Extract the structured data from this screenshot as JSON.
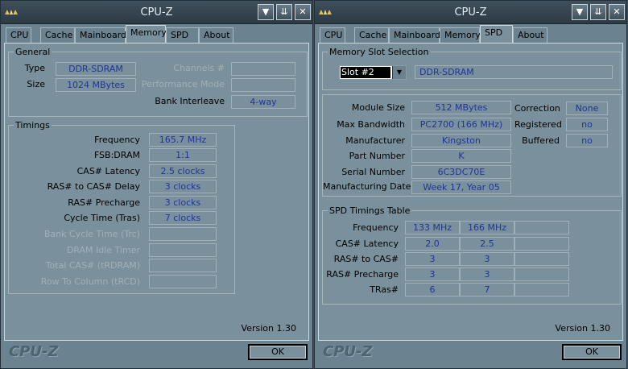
{
  "windows": [
    {
      "title": "CPU-Z",
      "tabs": [
        "CPU",
        "Cache",
        "Mainboard",
        "Memory",
        "SPD",
        "About"
      ],
      "active_tab": "Memory",
      "general": {
        "heading": "General",
        "type_label": "Type",
        "type_value": "DDR-SDRAM",
        "size_label": "Size",
        "size_value": "1024 MBytes",
        "channels_label": "Channels #",
        "channels_value": "",
        "perf_mode_label": "Performance Mode",
        "perf_mode_value": "",
        "bank_interleave_label": "Bank Interleave",
        "bank_interleave_value": "4-way"
      },
      "timings": {
        "heading": "Timings",
        "rows": [
          {
            "label": "Frequency",
            "value": "165.7 MHz",
            "enabled": true
          },
          {
            "label": "FSB:DRAM",
            "value": "1:1",
            "enabled": true
          },
          {
            "label": "CAS# Latency",
            "value": "2.5 clocks",
            "enabled": true
          },
          {
            "label": "RAS# to CAS# Delay",
            "value": "3 clocks",
            "enabled": true
          },
          {
            "label": "RAS# Precharge",
            "value": "3 clocks",
            "enabled": true
          },
          {
            "label": "Cycle Time (Tras)",
            "value": "7 clocks",
            "enabled": true
          },
          {
            "label": "Bank Cycle Time (Trc)",
            "value": "",
            "enabled": false
          },
          {
            "label": "DRAM Idle Timer",
            "value": "",
            "enabled": false
          },
          {
            "label": "Total CAS# (tRDRAM)",
            "value": "",
            "enabled": false
          },
          {
            "label": "Row To Column (tRCD)",
            "value": "",
            "enabled": false
          }
        ]
      },
      "version": "Version 1.30",
      "logo": "CPU-Z",
      "ok_label": "OK"
    },
    {
      "title": "CPU-Z",
      "tabs": [
        "CPU",
        "Cache",
        "Mainboard",
        "Memory",
        "SPD",
        "About"
      ],
      "active_tab": "SPD",
      "slot_selection": {
        "heading": "Memory Slot Selection",
        "selected_slot": "Slot #2",
        "slot_type": "DDR-SDRAM"
      },
      "module": {
        "rows": [
          {
            "label": "Module Size",
            "value": "512 MBytes"
          },
          {
            "label": "Max Bandwidth",
            "value": "PC2700 (166 MHz)"
          },
          {
            "label": "Manufacturer",
            "value": "Kingston"
          },
          {
            "label": "Part Number",
            "value": "K"
          },
          {
            "label": "Serial Number",
            "value": "6C3DC70E"
          },
          {
            "label": "Manufacturing Date",
            "value": "Week 17, Year 05"
          }
        ],
        "correction_label": "Correction",
        "correction_value": "None",
        "registered_label": "Registered",
        "registered_value": "no",
        "buffered_label": "Buffered",
        "buffered_value": "no"
      },
      "spd_table": {
        "heading": "SPD Timings Table",
        "rows": [
          {
            "label": "Frequency",
            "values": [
              "133 MHz",
              "166 MHz",
              ""
            ]
          },
          {
            "label": "CAS# Latency",
            "values": [
              "2.0",
              "2.5",
              ""
            ]
          },
          {
            "label": "RAS# to CAS#",
            "values": [
              "3",
              "3",
              ""
            ]
          },
          {
            "label": "RAS# Precharge",
            "values": [
              "3",
              "3",
              ""
            ]
          },
          {
            "label": "TRas#",
            "values": [
              "6",
              "7",
              ""
            ]
          }
        ]
      },
      "version": "Version 1.30",
      "logo": "CPU-Z",
      "ok_label": "OK"
    }
  ],
  "titlebar_buttons": [
    "minimize",
    "rollup",
    "close"
  ],
  "colors": {
    "background": "#6b8290",
    "panel": "#7a909c",
    "value_text": "#22349a",
    "titlebar": "#2c3a44"
  }
}
